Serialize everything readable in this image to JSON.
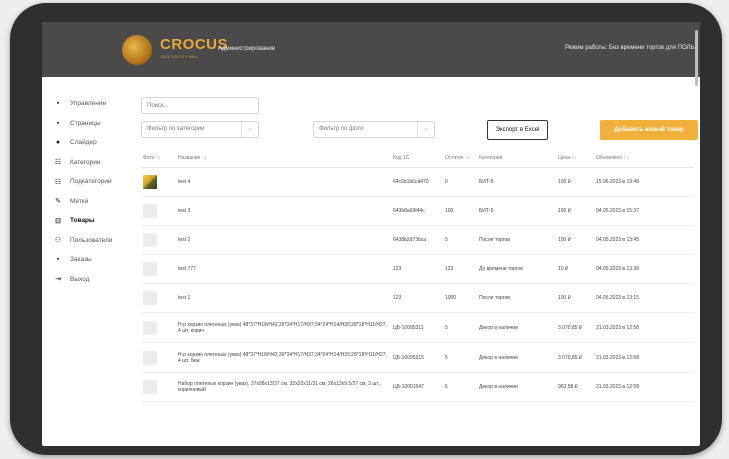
{
  "header": {
    "logo_text": "CROCUS",
    "logo_sub": "CROCUS CITY HALL",
    "admin_title": "Администрирование",
    "mode": "Режим работы: Без времени торгов для ПОЛЬЗ"
  },
  "sidebar": {
    "items": [
      {
        "icon": "dashboard-icon",
        "glyph": "▪",
        "label": "Управление"
      },
      {
        "icon": "pages-icon",
        "glyph": "▪",
        "label": "Страницы"
      },
      {
        "icon": "slider-icon",
        "glyph": "●",
        "label": "Слайдер"
      },
      {
        "icon": "categories-icon",
        "glyph": "☷",
        "label": "Категории"
      },
      {
        "icon": "subcategories-icon",
        "glyph": "☷",
        "label": "Подкатегории"
      },
      {
        "icon": "tags-icon",
        "glyph": "✎",
        "label": "Метки"
      },
      {
        "icon": "products-icon",
        "glyph": "⊡",
        "label": "Товары"
      },
      {
        "icon": "users-icon",
        "glyph": "⚇",
        "label": "Пользователи"
      },
      {
        "icon": "orders-icon",
        "glyph": "▪",
        "label": "Заказы"
      },
      {
        "icon": "logout-icon",
        "glyph": "⇥",
        "label": "Выход"
      }
    ]
  },
  "filters": {
    "search_placeholder": "Поиск...",
    "category_placeholder": "Фильтр по категории",
    "photo_placeholder": "Фильтр по фото",
    "export_label": "Экспорт в Excel",
    "add_label": "Добавить новый товар"
  },
  "table": {
    "columns": [
      "Фото ↑↓",
      "Название ↑↓",
      "Код 1С",
      "Остаток ↑↓",
      "Категория",
      "Цена ↑↓",
      "Обновлено ↑↓"
    ],
    "rows": [
      {
        "has_image": true,
        "name": "test 4",
        "code": "64c0b1b6c4470",
        "stock": "0",
        "category": "БИТ-5",
        "price": "100 ₽",
        "updated": "15.06.2023 в 19:48"
      },
      {
        "has_image": false,
        "name": "test 3",
        "code": "643b8a69f44c",
        "stock": "100",
        "category": "БИТ-5",
        "price": "100 ₽",
        "updated": "04.05.2023 в 15:37"
      },
      {
        "has_image": false,
        "name": "test 2",
        "code": "6438b2d73bca",
        "stock": "5",
        "category": "После торгов",
        "price": "100 ₽",
        "updated": "04.05.2023 в 13:45"
      },
      {
        "has_image": false,
        "name": "test 777",
        "code": "123",
        "stock": "123",
        "category": "До времени торгов",
        "price": "10 ₽",
        "updated": "04.05.2023 в 13:38"
      },
      {
        "has_image": false,
        "name": "test 1",
        "code": "123",
        "stock": "1000",
        "category": "После торгов",
        "price": "100 ₽",
        "updated": "04.05.2023 в 13:15"
      },
      {
        "has_image": false,
        "name": "Н-р корзин плетеных (уваз) 48*37*Н18/Н42;39*34*Н17/Н37;34*24*Н14/Н33;28*18*Н11/Н27, 4 шт. корич",
        "code": "ЦБ-10095311",
        "stock": "5",
        "category": "Декор в наличии",
        "price": "3 070,85 ₽",
        "updated": "21.03.2023 в 12:58"
      },
      {
        "has_image": false,
        "name": "Н-р корзин плетеных (уваз) 48*37*Н18/Н42;39*34*Н17/Н37;34*24*Н14/Н33;28*18*Н11/Н27, 4 шт. беж",
        "code": "ЦБ-10095315",
        "stock": "5",
        "category": "Декор в наличии",
        "price": "3 070,85 ₽",
        "updated": "21.03.2023 в 12:58"
      },
      {
        "has_image": false,
        "name": "Набор плетеных корзин (уваз), 37х28х13/37 см, 32х22х11/31 см, 26х13х9,5/27 см, 3 шт., коричневый",
        "code": "ЦБ-10001547",
        "stock": "5",
        "category": "Декор в наличии",
        "price": "963,58 ₽",
        "updated": "21.03.2023 в 12:58"
      }
    ]
  }
}
